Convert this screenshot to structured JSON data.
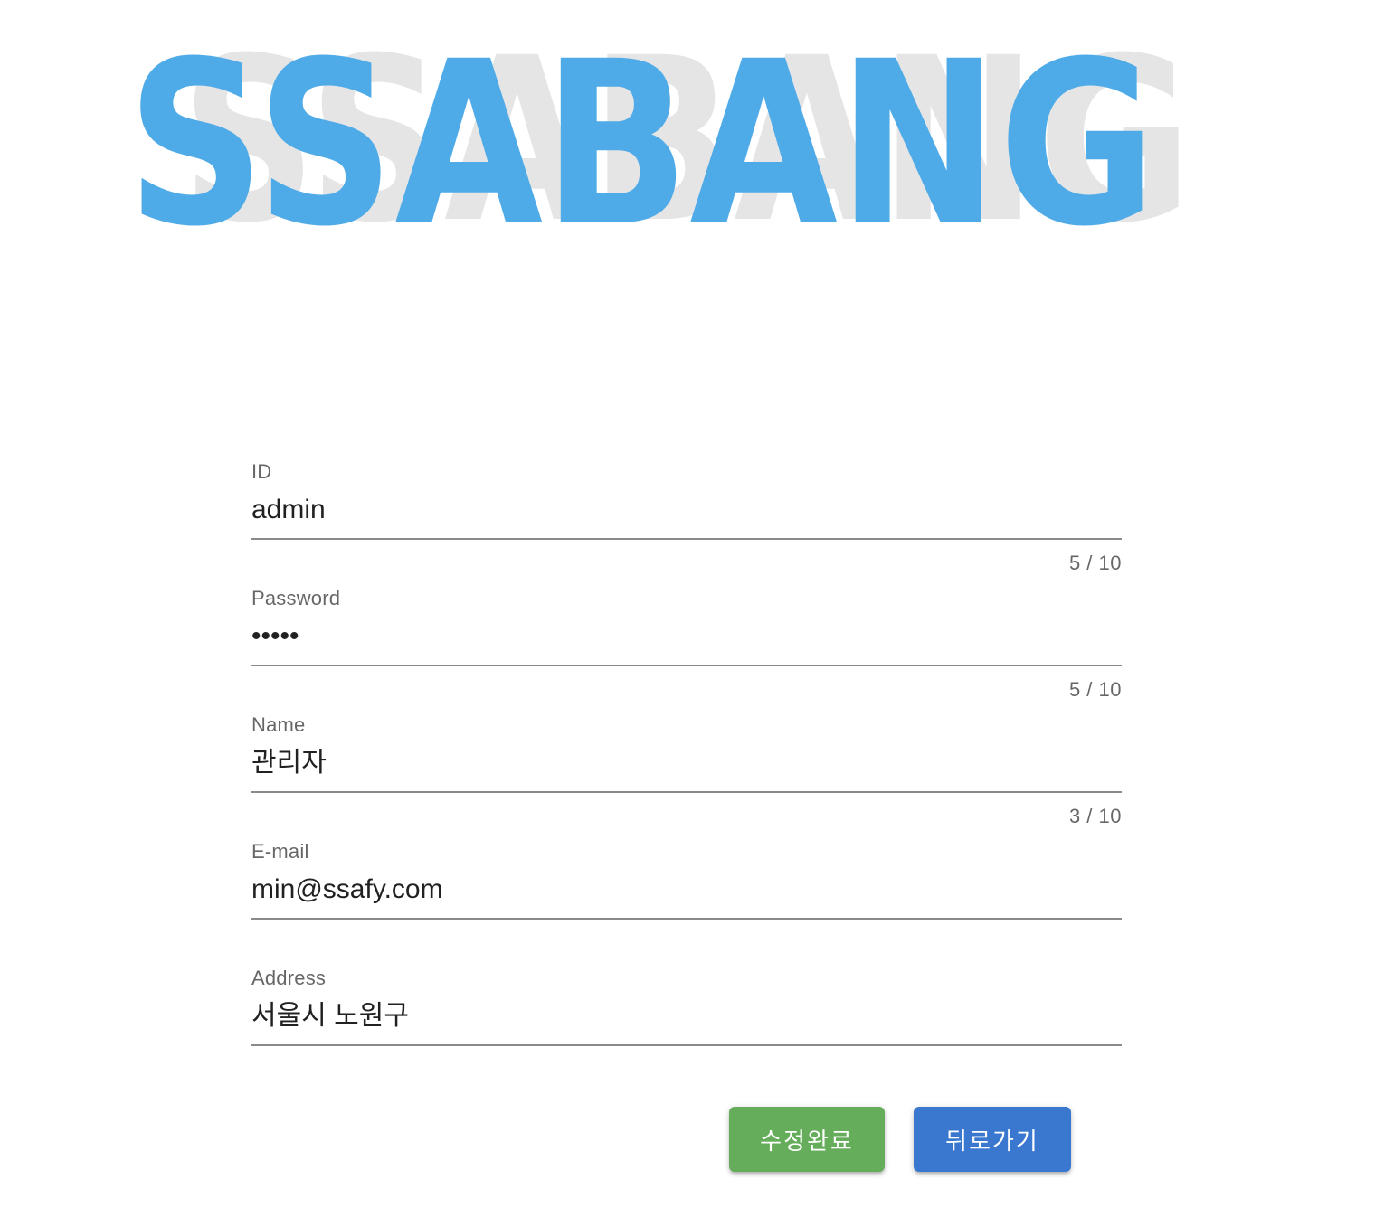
{
  "logo": {
    "text": "SSABANG",
    "color": "#4fabe8",
    "shadow_color": "#e5e5e5"
  },
  "form": {
    "fields": [
      {
        "label": "ID",
        "value": "admin",
        "counter": "5 / 10"
      },
      {
        "label": "Password",
        "value": "•••••",
        "counter": "5 / 10"
      },
      {
        "label": "Name",
        "value": "관리자",
        "counter": "3 / 10"
      },
      {
        "label": "E-mail",
        "value": "min@ssafy.com"
      },
      {
        "label": "Address",
        "value": "서울시 노원구"
      }
    ]
  },
  "buttons": {
    "save": {
      "label": "수정완료",
      "color": "#66ad5b"
    },
    "back": {
      "label": "뒤로가기",
      "color": "#3a77cf"
    }
  }
}
